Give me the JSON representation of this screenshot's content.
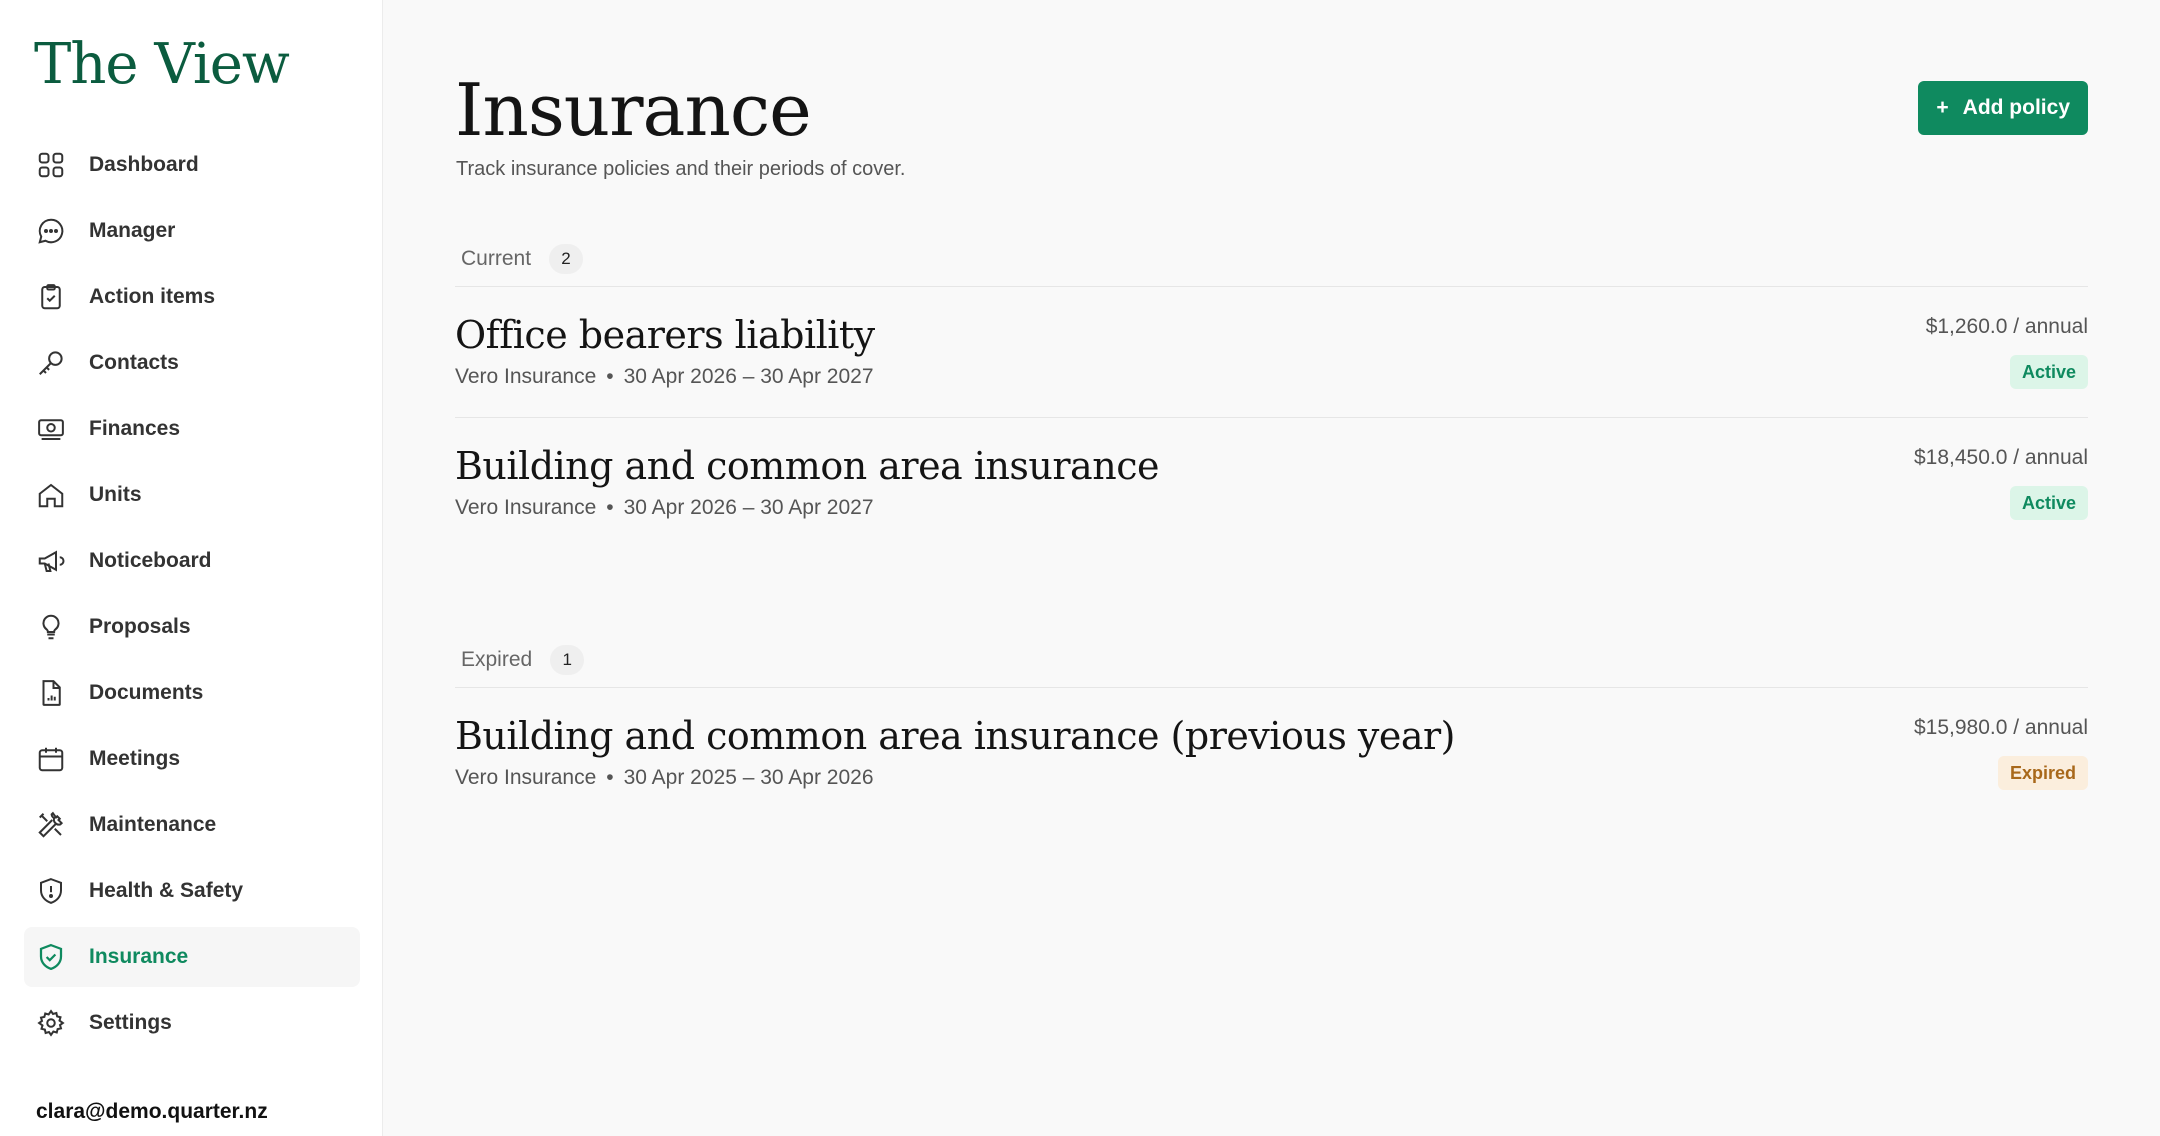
{
  "app": {
    "brand": "The View",
    "user_email": "clara@demo.quarter.nz"
  },
  "sidebar": {
    "items": [
      {
        "label": "Dashboard",
        "icon": "grid-icon",
        "active": false
      },
      {
        "label": "Manager",
        "icon": "chat-bubble-icon",
        "active": false
      },
      {
        "label": "Action items",
        "icon": "clipboard-check-icon",
        "active": false
      },
      {
        "label": "Contacts",
        "icon": "key-icon",
        "active": false
      },
      {
        "label": "Finances",
        "icon": "banknote-icon",
        "active": false
      },
      {
        "label": "Units",
        "icon": "home-icon",
        "active": false
      },
      {
        "label": "Noticeboard",
        "icon": "megaphone-icon",
        "active": false
      },
      {
        "label": "Proposals",
        "icon": "lightbulb-icon",
        "active": false
      },
      {
        "label": "Documents",
        "icon": "document-chart-icon",
        "active": false
      },
      {
        "label": "Meetings",
        "icon": "calendar-icon",
        "active": false
      },
      {
        "label": "Maintenance",
        "icon": "tools-icon",
        "active": false
      },
      {
        "label": "Health & Safety",
        "icon": "shield-alert-icon",
        "active": false
      },
      {
        "label": "Insurance",
        "icon": "shield-check-icon",
        "active": true
      },
      {
        "label": "Settings",
        "icon": "gear-icon",
        "active": false
      }
    ]
  },
  "header": {
    "title": "Insurance",
    "subtitle": "Track insurance policies and their periods of cover.",
    "add_button_icon": "+",
    "add_button_label": "Add policy"
  },
  "sections": {
    "current": {
      "label": "Current",
      "count": "2",
      "policies": [
        {
          "title": "Office bearers liability",
          "insurer": "Vero Insurance",
          "separator": "•",
          "period": "30 Apr 2026 – 30 Apr 2027",
          "amount": "$1,260.0 / annual",
          "status": "Active"
        },
        {
          "title": "Building and common area insurance",
          "insurer": "Vero Insurance",
          "separator": "•",
          "period": "30 Apr 2026 – 30 Apr 2027",
          "amount": "$18,450.0 / annual",
          "status": "Active"
        }
      ]
    },
    "expired": {
      "label": "Expired",
      "count": "1",
      "policies": [
        {
          "title": "Building and common area insurance (previous year)",
          "insurer": "Vero Insurance",
          "separator": "•",
          "period": "30 Apr 2025 – 30 Apr 2026",
          "amount": "$15,980.0 / annual",
          "status": "Expired"
        }
      ]
    }
  },
  "colors": {
    "brand": "#0b5c3f",
    "accent": "#0f8a5f",
    "active_badge_bg": "#dcf5e8",
    "expired_badge_bg": "#fbeedd",
    "expired_badge_text": "#a8681a"
  }
}
